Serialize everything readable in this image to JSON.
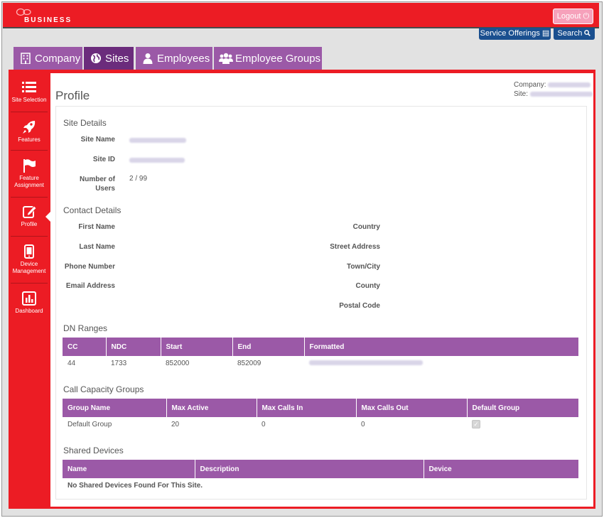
{
  "brand": {
    "name": "BUSINESS"
  },
  "header": {
    "logout_label": "Logout",
    "service_offerings_label": "Service Offerings",
    "search_label": "Search"
  },
  "tabs": [
    {
      "label": "Company",
      "icon": "building-icon"
    },
    {
      "label": "Sites",
      "icon": "globe-icon",
      "active": true
    },
    {
      "label": "Employees",
      "icon": "user-icon"
    },
    {
      "label": "Employee Groups",
      "icon": "users-icon"
    }
  ],
  "sidebar": {
    "items": [
      {
        "label": "Site Selection",
        "icon": "list-icon"
      },
      {
        "label": "Features",
        "icon": "rocket-icon"
      },
      {
        "label": "Feature Assignment",
        "icon": "flag-icon"
      },
      {
        "label": "Profile",
        "icon": "edit-icon",
        "active": true
      },
      {
        "label": "Device Management",
        "icon": "tablet-icon"
      },
      {
        "label": "Dashboard",
        "icon": "bar-chart-icon"
      }
    ]
  },
  "page": {
    "title": "Profile",
    "company_label": "Company:",
    "site_label": "Site:"
  },
  "site_details": {
    "title": "Site Details",
    "site_name_label": "Site Name",
    "site_id_label": "Site ID",
    "number_of_users_label": "Number of Users",
    "number_of_users_value": "2 / 99"
  },
  "contact_details": {
    "title": "Contact Details",
    "first_name_label": "First Name",
    "last_name_label": "Last Name",
    "phone_number_label": "Phone Number",
    "email_address_label": "Email Address",
    "country_label": "Country",
    "street_address_label": "Street Address",
    "town_city_label": "Town/City",
    "county_label": "County",
    "postal_code_label": "Postal Code"
  },
  "dn_ranges": {
    "title": "DN Ranges",
    "columns": [
      "CC",
      "NDC",
      "Start",
      "End",
      "Formatted"
    ],
    "rows": [
      {
        "cc": "44",
        "ndc": "1733",
        "start": "852000",
        "end": "852009"
      }
    ]
  },
  "call_capacity_groups": {
    "title": "Call Capacity Groups",
    "columns": [
      "Group Name",
      "Max Active",
      "Max Calls In",
      "Max Calls Out",
      "Default Group"
    ],
    "rows": [
      {
        "group_name": "Default Group",
        "max_active": "20",
        "max_calls_in": "0",
        "max_calls_out": "0",
        "default_group": true
      }
    ]
  },
  "shared_devices": {
    "title": "Shared Devices",
    "columns": [
      "Name",
      "Description",
      "Device"
    ],
    "empty_message": "No Shared Devices Found For This Site."
  },
  "colors": {
    "brand_red": "#ec1c24",
    "purple": "#9b59a7",
    "purple_dark": "#6b2c7c",
    "blue": "#1a4f8f"
  }
}
